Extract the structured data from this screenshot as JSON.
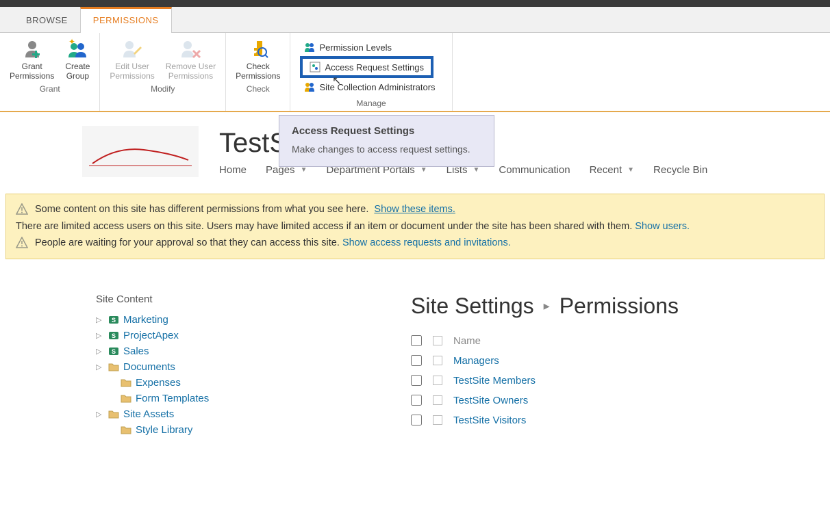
{
  "tabs": {
    "browse": "BROWSE",
    "permissions": "PERMISSIONS"
  },
  "ribbon": {
    "grant": {
      "grantPermissions": "Grant\nPermissions",
      "createGroup": "Create\nGroup",
      "label": "Grant"
    },
    "modify": {
      "editUser": "Edit User\nPermissions",
      "removeUser": "Remove User\nPermissions",
      "label": "Modify"
    },
    "check": {
      "checkPermissions": "Check\nPermissions",
      "label": "Check"
    },
    "manage": {
      "permissionLevels": "Permission Levels",
      "accessRequest": "Access Request Settings",
      "siteCollectionAdmins": "Site Collection Administrators",
      "label": "Manage"
    }
  },
  "tooltip": {
    "title": "Access Request Settings",
    "body": "Make changes to access request settings."
  },
  "site": {
    "title": "TestSite"
  },
  "nav": {
    "home": "Home",
    "pages": "Pages",
    "departmentPortals": "Department Portals",
    "lists": "Lists",
    "communication": "Communication",
    "recent": "Recent",
    "recycle": "Recycle Bin"
  },
  "warnings": {
    "line1a": "Some content on this site has different permissions from what you see here.",
    "line1link": "Show these items.",
    "line2a": "There are limited access users on this site. Users may have limited access if an item or document under the site has been shared with them.",
    "line2link": "Show users.",
    "line3a": "People are waiting for your approval so that they can access this site.",
    "line3link": "Show access requests and invitations."
  },
  "tree": {
    "title": "Site Content",
    "items": [
      {
        "label": "Marketing",
        "icon": "sp",
        "expandable": true
      },
      {
        "label": "ProjectApex",
        "icon": "sp",
        "expandable": true
      },
      {
        "label": "Sales",
        "icon": "sp",
        "expandable": true
      },
      {
        "label": "Documents",
        "icon": "folder",
        "expandable": true
      },
      {
        "label": "Expenses",
        "icon": "folder",
        "expandable": false,
        "indent": true
      },
      {
        "label": "Form Templates",
        "icon": "folder",
        "expandable": false,
        "indent": true
      },
      {
        "label": "Site Assets",
        "icon": "folder",
        "expandable": true
      },
      {
        "label": "Style Library",
        "icon": "folder",
        "expandable": false,
        "indent": true
      }
    ]
  },
  "permissions": {
    "crumb1": "Site Settings",
    "crumb2": "Permissions",
    "headerName": "Name",
    "rows": [
      {
        "name": "Managers"
      },
      {
        "name": "TestSite Members"
      },
      {
        "name": "TestSite Owners"
      },
      {
        "name": "TestSite Visitors"
      }
    ]
  }
}
